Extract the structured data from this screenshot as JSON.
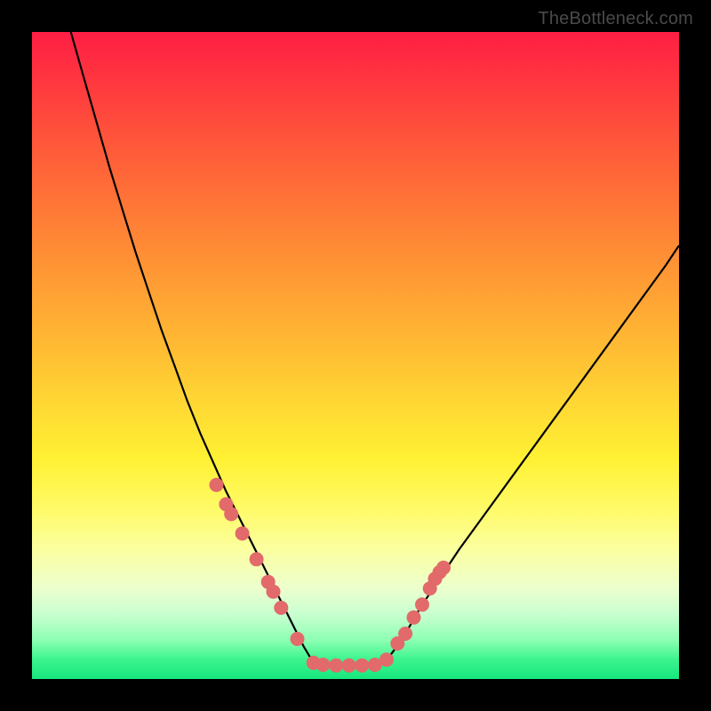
{
  "watermark": "TheBottleneck.com",
  "chart_data": {
    "type": "line",
    "title": "",
    "xlabel": "",
    "ylabel": "",
    "xlim": [
      0,
      100
    ],
    "ylim": [
      0,
      100
    ],
    "grid": false,
    "legend": false,
    "series": [
      {
        "name": "left-curve",
        "x": [
          6,
          8,
          10,
          12,
          14,
          16,
          18,
          20,
          22,
          24,
          26,
          28,
          30,
          32,
          34,
          36,
          38,
          40,
          42,
          43.5
        ],
        "y": [
          100,
          93,
          86,
          79,
          72.5,
          66,
          60,
          54,
          48.5,
          43,
          38,
          33.5,
          29,
          25,
          21,
          17,
          13,
          9,
          5,
          2.5
        ]
      },
      {
        "name": "trough",
        "x": [
          43.5,
          45,
          47,
          49,
          51,
          53,
          54.5
        ],
        "y": [
          2.5,
          2.2,
          2.1,
          2.1,
          2.1,
          2.2,
          2.5
        ]
      },
      {
        "name": "right-curve",
        "x": [
          54.5,
          56,
          58,
          60,
          63,
          66,
          70,
          74,
          78,
          82,
          86,
          90,
          94,
          98,
          100
        ],
        "y": [
          2.5,
          4.5,
          7.5,
          11,
          15.5,
          20,
          25.5,
          31,
          36.5,
          42,
          47.5,
          53,
          58.5,
          64,
          67
        ]
      }
    ],
    "markers": [
      {
        "name": "left-dots",
        "x": [
          28.5,
          30,
          30.8,
          32.5,
          34.7,
          36.5,
          37.3,
          38.5,
          41,
          43.5
        ],
        "y": [
          30,
          27,
          25.5,
          22.5,
          18.5,
          15,
          13.5,
          11,
          6.2,
          2.5
        ]
      },
      {
        "name": "trough-dots",
        "x": [
          45,
          47,
          49,
          51,
          53
        ],
        "y": [
          2.2,
          2.1,
          2.1,
          2.1,
          2.2
        ]
      },
      {
        "name": "right-dots",
        "x": [
          54.8,
          56.5,
          57.7,
          59,
          60.3,
          61.5,
          62.3,
          63,
          63.6
        ],
        "y": [
          3,
          5.5,
          7,
          9.5,
          11.5,
          14,
          15.5,
          16.5,
          17.2
        ]
      }
    ],
    "marker_style": {
      "r": 8,
      "fill": "#e26a6a",
      "stroke": "none"
    }
  }
}
